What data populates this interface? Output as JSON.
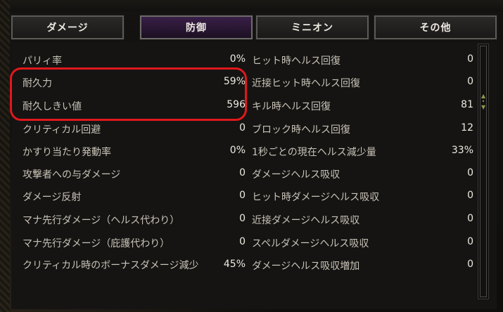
{
  "tabs": [
    {
      "label": "ダメージ",
      "active": false
    },
    {
      "label": "防御",
      "active": true
    },
    {
      "label": "ミニオン",
      "active": false
    },
    {
      "label": "その他",
      "active": false
    }
  ],
  "left_stats": [
    {
      "label": "パリィ率",
      "value": "0%"
    },
    {
      "label": "耐久力",
      "value": "59%"
    },
    {
      "label": "耐久しきい値",
      "value": "596"
    },
    {
      "label": "クリティカル回避",
      "value": "0"
    },
    {
      "label": "かすり当たり発動率",
      "value": "0%"
    },
    {
      "label": "攻撃者への与ダメージ",
      "value": "0"
    },
    {
      "label": "ダメージ反射",
      "value": "0"
    },
    {
      "label": "マナ先行ダメージ（ヘルス代わり）",
      "value": "0"
    },
    {
      "label": "マナ先行ダメージ（庇護代わり）",
      "value": "0"
    },
    {
      "label": "クリティカル時のボーナスダメージ減少",
      "value": "45%"
    }
  ],
  "right_stats": [
    {
      "label": "ヒット時ヘルス回復",
      "value": "0"
    },
    {
      "label": "近接ヒット時ヘルス回復",
      "value": "0"
    },
    {
      "label": "キル時ヘルス回復",
      "value": "81"
    },
    {
      "label": "ブロック時ヘルス回復",
      "value": "12"
    },
    {
      "label": "1秒ごとの現在ヘルス減少量",
      "value": "33%"
    },
    {
      "label": "ダメージヘルス吸収",
      "value": "0"
    },
    {
      "label": "ヒット時ダメージヘルス吸収",
      "value": "0"
    },
    {
      "label": "近接ダメージヘルス吸収",
      "value": "0"
    },
    {
      "label": "スペルダメージヘルス吸収",
      "value": "0"
    },
    {
      "label": "ダメージヘルス吸収増加",
      "value": "0"
    }
  ],
  "colors": {
    "highlight": "#e0181b",
    "active_tab": "#3a1f48"
  }
}
